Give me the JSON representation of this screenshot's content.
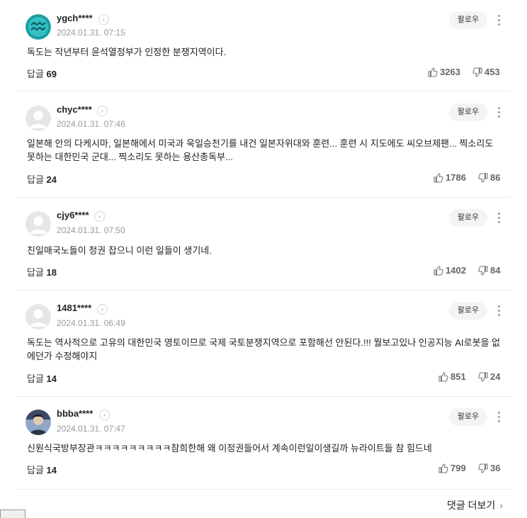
{
  "comments": [
    {
      "nickname": "ygch****",
      "date": "2024.01.31. 07:15",
      "text": "독도는 작년부터 윤석열정부가 인정한 분쟁지역이다.",
      "reply_label": "답글",
      "reply_count": "69",
      "likes": "3263",
      "dislikes": "453",
      "follow_label": "팔로우",
      "avatar": "aquarius-avatar"
    },
    {
      "nickname": "chyc****",
      "date": "2024.01.31. 07:46",
      "text": "일본해 안의 다케시마, 일본해에서 미국과 욱일승천기를 내건 일본자위대와 훈련... 훈련 시 지도에도 씨오브제팬... 찍소리도 못하는 대한민국 군대... 찍소리도 못하는 용산총독부...",
      "reply_label": "답글",
      "reply_count": "24",
      "likes": "1786",
      "dislikes": "86",
      "follow_label": "팔로우",
      "avatar": "default-avatar"
    },
    {
      "nickname": "cjy6****",
      "date": "2024.01.31. 07:50",
      "text": "친일매국노들이 정권 잡으니 이런 일들이 생기네.",
      "reply_label": "답글",
      "reply_count": "18",
      "likes": "1402",
      "dislikes": "84",
      "follow_label": "팔로우",
      "avatar": "default-avatar"
    },
    {
      "nickname": "1481****",
      "date": "2024.01.31. 06:49",
      "text": "독도는 역사적으로 고유의 대한민국 영토이므로 국제 국토분쟁지역으로 포함해선 안된다.!!! 뭘보고있나 인공지능 AI로봇을 없에던가 수정해야지",
      "reply_label": "답글",
      "reply_count": "14",
      "likes": "851",
      "dislikes": "24",
      "follow_label": "팔로우",
      "avatar": "default-avatar"
    },
    {
      "nickname": "bbba****",
      "date": "2024.01.31. 07:47",
      "text": "신원식국방부장관ㅋㅋㅋㅋㅋㅋㅋㅋㅋ참희한해 왜 이정권들어서 계속이런일이생길까 뉴라이트들 참 힘드네",
      "reply_label": "답글",
      "reply_count": "14",
      "likes": "799",
      "dislikes": "36",
      "follow_label": "팔로우",
      "avatar": "photo-avatar"
    }
  ],
  "more_comments_label": "댓글 더보기",
  "colors": {
    "aquarius_bg": "#1aa8a0",
    "default_avatar_bg": "#e6e6e6"
  },
  "icons": {
    "like": "thumbs-up-icon",
    "dislike": "thumbs-down-icon",
    "more": "kebab-icon",
    "arrow": "chevron-right-icon"
  }
}
